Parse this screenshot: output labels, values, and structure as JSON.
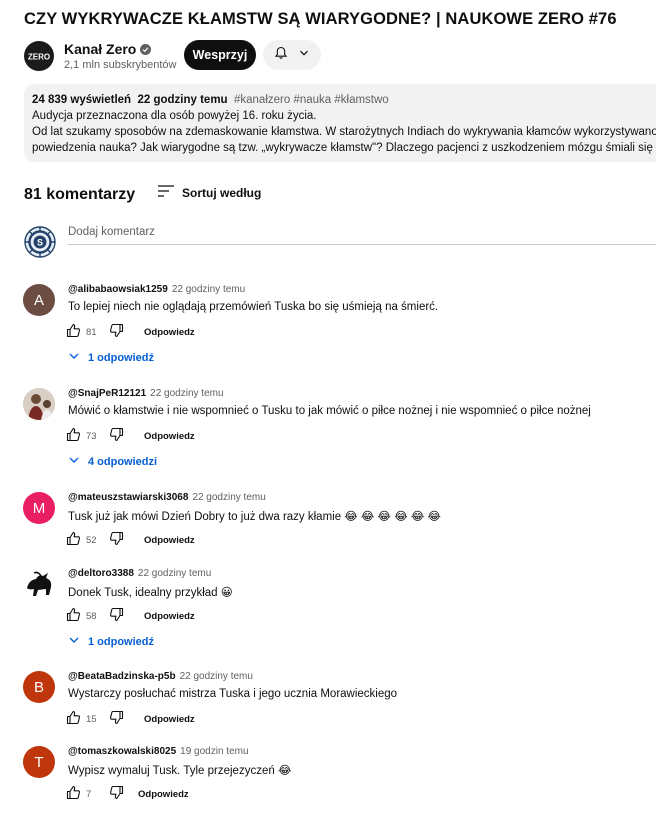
{
  "video": {
    "title": "CZY WYKRYWACZE KŁAMSTW SĄ WIARYGODNE? | NAUKOWE ZERO #76"
  },
  "channel": {
    "name": "Kanał Zero",
    "subscribers": "2,1 mln subskrybentów",
    "logo_text": "ZERO",
    "join_label": "Wesprzyj"
  },
  "description": {
    "views": "24 839 wyświetleń",
    "age": "22 godziny temu",
    "tags": "#kanałzero #nauka #kłamstwo",
    "lines": [
      "Audycja przeznaczona dla osób powyżej 16. roku życia.",
      "Od lat szukamy sposobów na zdemaskowanie kłamstwa. W starożytnych Indiach do wykrywania kłamców wykorzystywano na",
      "powiedzenia nauka? Jak wiarygodne są tzw. „wykrywacze kłamstw\"? Dlaczego pacjenci z uszkodzeniem mózgu śmiali się z Bi"
    ]
  },
  "comments_header": {
    "count": "81 komentarzy",
    "sort_label": "Sortuj według",
    "add_placeholder": "Dodaj komentarz"
  },
  "reply_label": "Odpowiedz",
  "colors": {
    "reply_link": "#065fd4",
    "avatar_a": "#6d4c41",
    "avatar_m": "#e91e63",
    "avatar_b": "#bf360c",
    "avatar_t": "#bf360c"
  },
  "comments": [
    {
      "initial": "A",
      "handle": "@alibabaowsiak1259",
      "time": "22 godziny temu",
      "text": "To lepiej niech nie oglądają przemówień Tuska bo się uśmieją na śmierć.",
      "likes": "81",
      "replies": "1 odpowiedź"
    },
    {
      "initial": "",
      "handle": "@SnajPeR12121",
      "time": "22 godziny temu",
      "text": "Mówić o kłamstwie i nie wspomnieć o Tusku to jak mówić o piłce nożnej i nie wspomnieć o piłce nożnej",
      "likes": "73",
      "replies": "4 odpowiedzi"
    },
    {
      "initial": "M",
      "handle": "@mateuszstawiarski3068",
      "time": "22 godziny temu",
      "text": "Tusk już jak mówi Dzień Dobry to już  dwa razy kłamie 😂 😂 😂 😂 😂 😂",
      "likes": "52",
      "replies": ""
    },
    {
      "initial": "",
      "handle": "@deltoro3388",
      "time": "22 godziny temu",
      "text": "Donek Tusk, idealny przykład 😀",
      "likes": "58",
      "replies": "1 odpowiedź"
    },
    {
      "initial": "B",
      "handle": "@BeataBadzinska-p5b",
      "time": "22 godziny temu",
      "text": "Wystarczy posłuchać mistrza Tuska i jego ucznia Morawieckiego",
      "likes": "15",
      "replies": ""
    },
    {
      "initial": "T",
      "handle": "@tomaszkowalski8025",
      "time": "19 godzin temu",
      "text": "Wypisz wymaluj Tusk. Tyle przejezyczeń 😂",
      "likes": "7",
      "replies": ""
    }
  ]
}
